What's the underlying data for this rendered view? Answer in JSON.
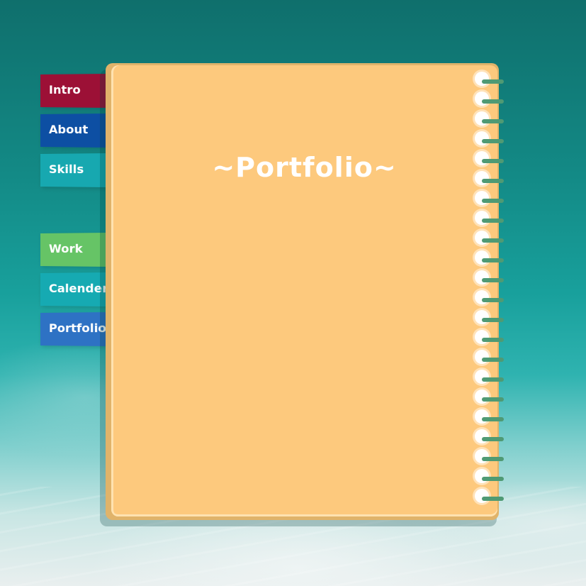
{
  "nav": {
    "tabs": [
      {
        "label": "Intro",
        "color": "#9c1036"
      },
      {
        "label": "About",
        "color": "#0d4fa3"
      },
      {
        "label": "Skills",
        "color": "#17a8b0"
      },
      {
        "label": "Work",
        "color": "#66c466"
      },
      {
        "label": "Calender",
        "color": "#16aab2"
      },
      {
        "label": "Portfolio",
        "color": "#2e72c4"
      }
    ]
  },
  "notebook": {
    "title": "~Portfolio~",
    "page_color": "#fdc97d",
    "ring_color": "#4f9a74"
  }
}
